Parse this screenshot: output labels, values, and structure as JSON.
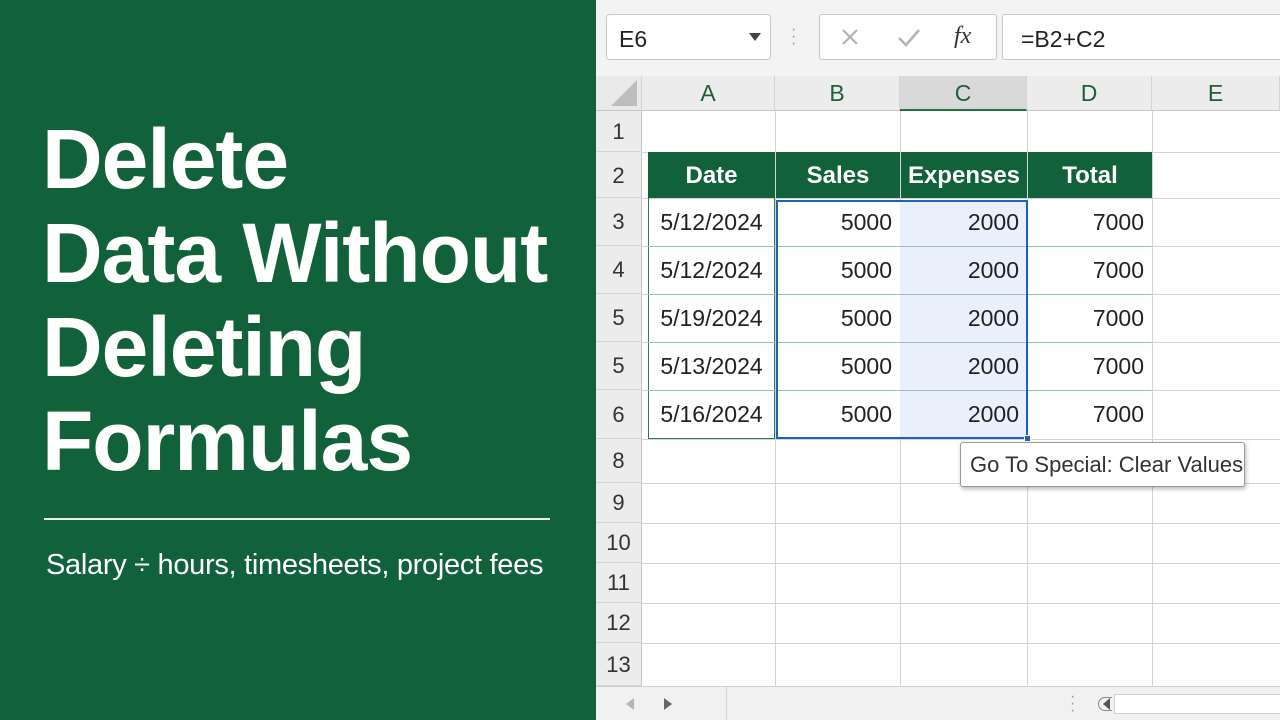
{
  "headline": {
    "lines": [
      "Delete",
      "Data Without",
      "Deleting",
      "Formulas"
    ]
  },
  "subtitle": "Salary ÷ hours, timesheets, project fees",
  "formula_bar": {
    "name_box": "E6",
    "cancel_icon": "cancel-x-icon",
    "enter_icon": "check-icon",
    "fx_label": "fx",
    "formula": "=B2+C2"
  },
  "columns": [
    "A",
    "B",
    "C",
    "D",
    "E"
  ],
  "row_numbers": [
    "1",
    "2",
    "3",
    "4",
    "5",
    "5",
    "6",
    "8",
    "9",
    "10",
    "11",
    "12",
    "13"
  ],
  "table": {
    "headers": [
      "Date",
      "Sales",
      "Expenses",
      "Total"
    ],
    "rows": [
      [
        "5/12/2024",
        "5000",
        "2000",
        "7000"
      ],
      [
        "5/12/2024",
        "5000",
        "2000",
        "7000"
      ],
      [
        "5/19/2024",
        "5000",
        "2000",
        "7000"
      ],
      [
        "5/13/2024",
        "5000",
        "2000",
        "7000"
      ],
      [
        "5/16/2024",
        "5000",
        "2000",
        "7000"
      ]
    ]
  },
  "tooltip": "Go To Special: Clear Values",
  "colors": {
    "brand_green": "#11623b",
    "selection_blue": "#1a63c7",
    "selection_fill": "#e9f0fb"
  }
}
